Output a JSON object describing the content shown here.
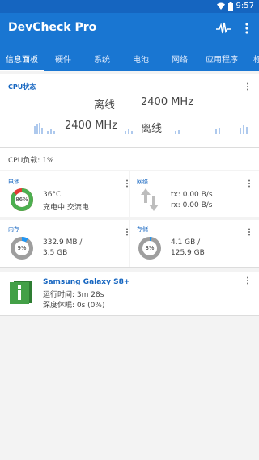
{
  "status_bar": {
    "time": "9:57",
    "icons": [
      "wifi-icon",
      "battery-icon"
    ]
  },
  "app": {
    "title": "DevCheck Pro"
  },
  "tabs": [
    "信息面板",
    "硬件",
    "系统",
    "电池",
    "网络",
    "应用程序",
    "标"
  ],
  "cpu": {
    "title": "CPU状态",
    "row1_left": "离线",
    "row1_right": "2400 MHz",
    "row2_left": "2400 MHz",
    "row2_right": "离线",
    "load": "CPU负载: 1%"
  },
  "battery": {
    "title": "电池",
    "percent": "86",
    "temperature": "36°C",
    "status": "充电中 交流电",
    "level": 0.86,
    "color": "#4caf50"
  },
  "network": {
    "title": "网络",
    "tx": "tx: 0.00 B/s",
    "rx": "rx: 0.00 B/s"
  },
  "memory": {
    "title": "内存",
    "percent": "9",
    "used": "332.9 MB /",
    "total": "3.5 GB",
    "level": 0.09
  },
  "storage": {
    "title": "存储",
    "percent": "3",
    "used": "4.1 GB /",
    "total": "125.9 GB",
    "level": 0.03
  },
  "device": {
    "name": "Samsung Galaxy S8+",
    "uptime": "运行时间: 3m 28s",
    "deep_sleep": "深度休眠: 0s (0%)"
  },
  "colors": {
    "primary": "#1976d2",
    "status_bar": "#1565c0",
    "accent": "#1565c0",
    "gauge_track": "#9e9e9e",
    "gauge_fill": "#2196f3"
  }
}
